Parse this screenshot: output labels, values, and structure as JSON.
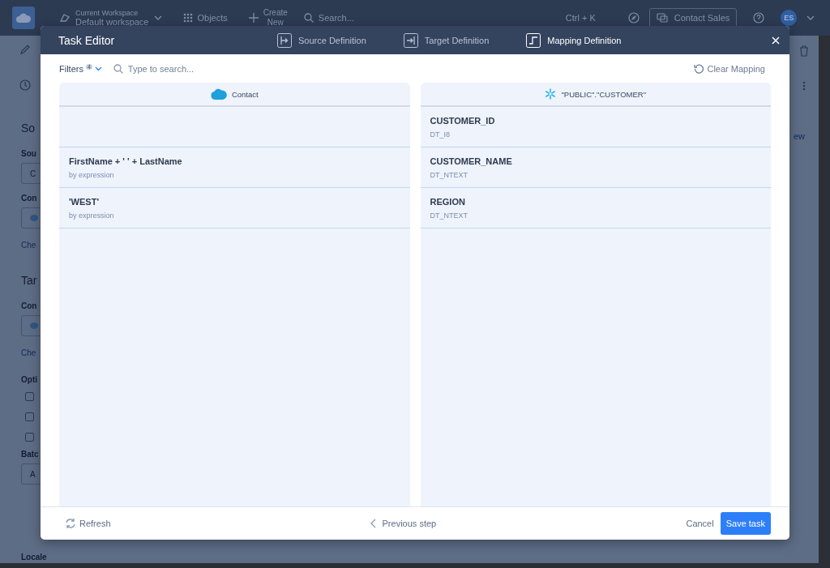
{
  "topbar": {
    "workspace_label": "Current Workspace",
    "workspace_name": "Default workspace",
    "objects": "Objects",
    "create": [
      "Create",
      "New"
    ],
    "search_placeholder": "Search...",
    "shortcut": "Ctrl + K",
    "contact_sales": "Contact Sales",
    "avatar": "ES"
  },
  "background": {
    "left": [
      {
        "kind": "heading",
        "text": "So"
      },
      {
        "kind": "label",
        "text": "Sou"
      },
      {
        "kind": "box",
        "text": "C"
      },
      {
        "kind": "label",
        "text": "Con"
      },
      {
        "kind": "iconbox"
      },
      {
        "kind": "link",
        "text": "Che"
      },
      {
        "kind": "heading",
        "text": "Tar"
      },
      {
        "kind": "label",
        "text": "Con"
      },
      {
        "kind": "iconbox"
      },
      {
        "kind": "link",
        "text": "Che"
      },
      {
        "kind": "label",
        "text": "Opti"
      },
      {
        "kind": "checkbox",
        "checked": false
      },
      {
        "kind": "checkbox",
        "checked": false
      },
      {
        "kind": "checkbox",
        "checked": false
      },
      {
        "kind": "label",
        "text": "Batc"
      },
      {
        "kind": "box",
        "text": "A"
      },
      {
        "kind": "label",
        "text": "Locale"
      }
    ],
    "right_link": "ew"
  },
  "modal": {
    "title": "Task Editor",
    "steps": [
      {
        "kind": "source",
        "label": "Source Definition",
        "selected": false
      },
      {
        "kind": "target",
        "label": "Target Definition",
        "selected": false
      },
      {
        "kind": "mapping",
        "label": "Mapping Definition",
        "selected": true
      }
    ],
    "filters": {
      "label": "Filters",
      "count": "4"
    },
    "search_placeholder": "Type to search...",
    "clear_mapping": "Clear Mapping",
    "source": {
      "title": "Contact",
      "rows": [
        {
          "kind": "empty"
        },
        {
          "kind": "field",
          "name": "FirstName + ' ' + LastName",
          "sub": "by expression"
        },
        {
          "kind": "field",
          "name": "'WEST'",
          "sub": "by expression"
        }
      ]
    },
    "target": {
      "title": "\"PUBLIC\".\"CUSTOMER\"",
      "rows": [
        {
          "kind": "field",
          "name": "CUSTOMER_ID",
          "sub": "DT_I8"
        },
        {
          "kind": "field",
          "name": "CUSTOMER_NAME",
          "sub": "DT_NTEXT"
        },
        {
          "kind": "field",
          "name": "REGION",
          "sub": "DT_NTEXT"
        }
      ]
    },
    "footer": {
      "refresh": "Refresh",
      "previous": "Previous step",
      "cancel": "Cancel",
      "save": "Save task"
    }
  }
}
